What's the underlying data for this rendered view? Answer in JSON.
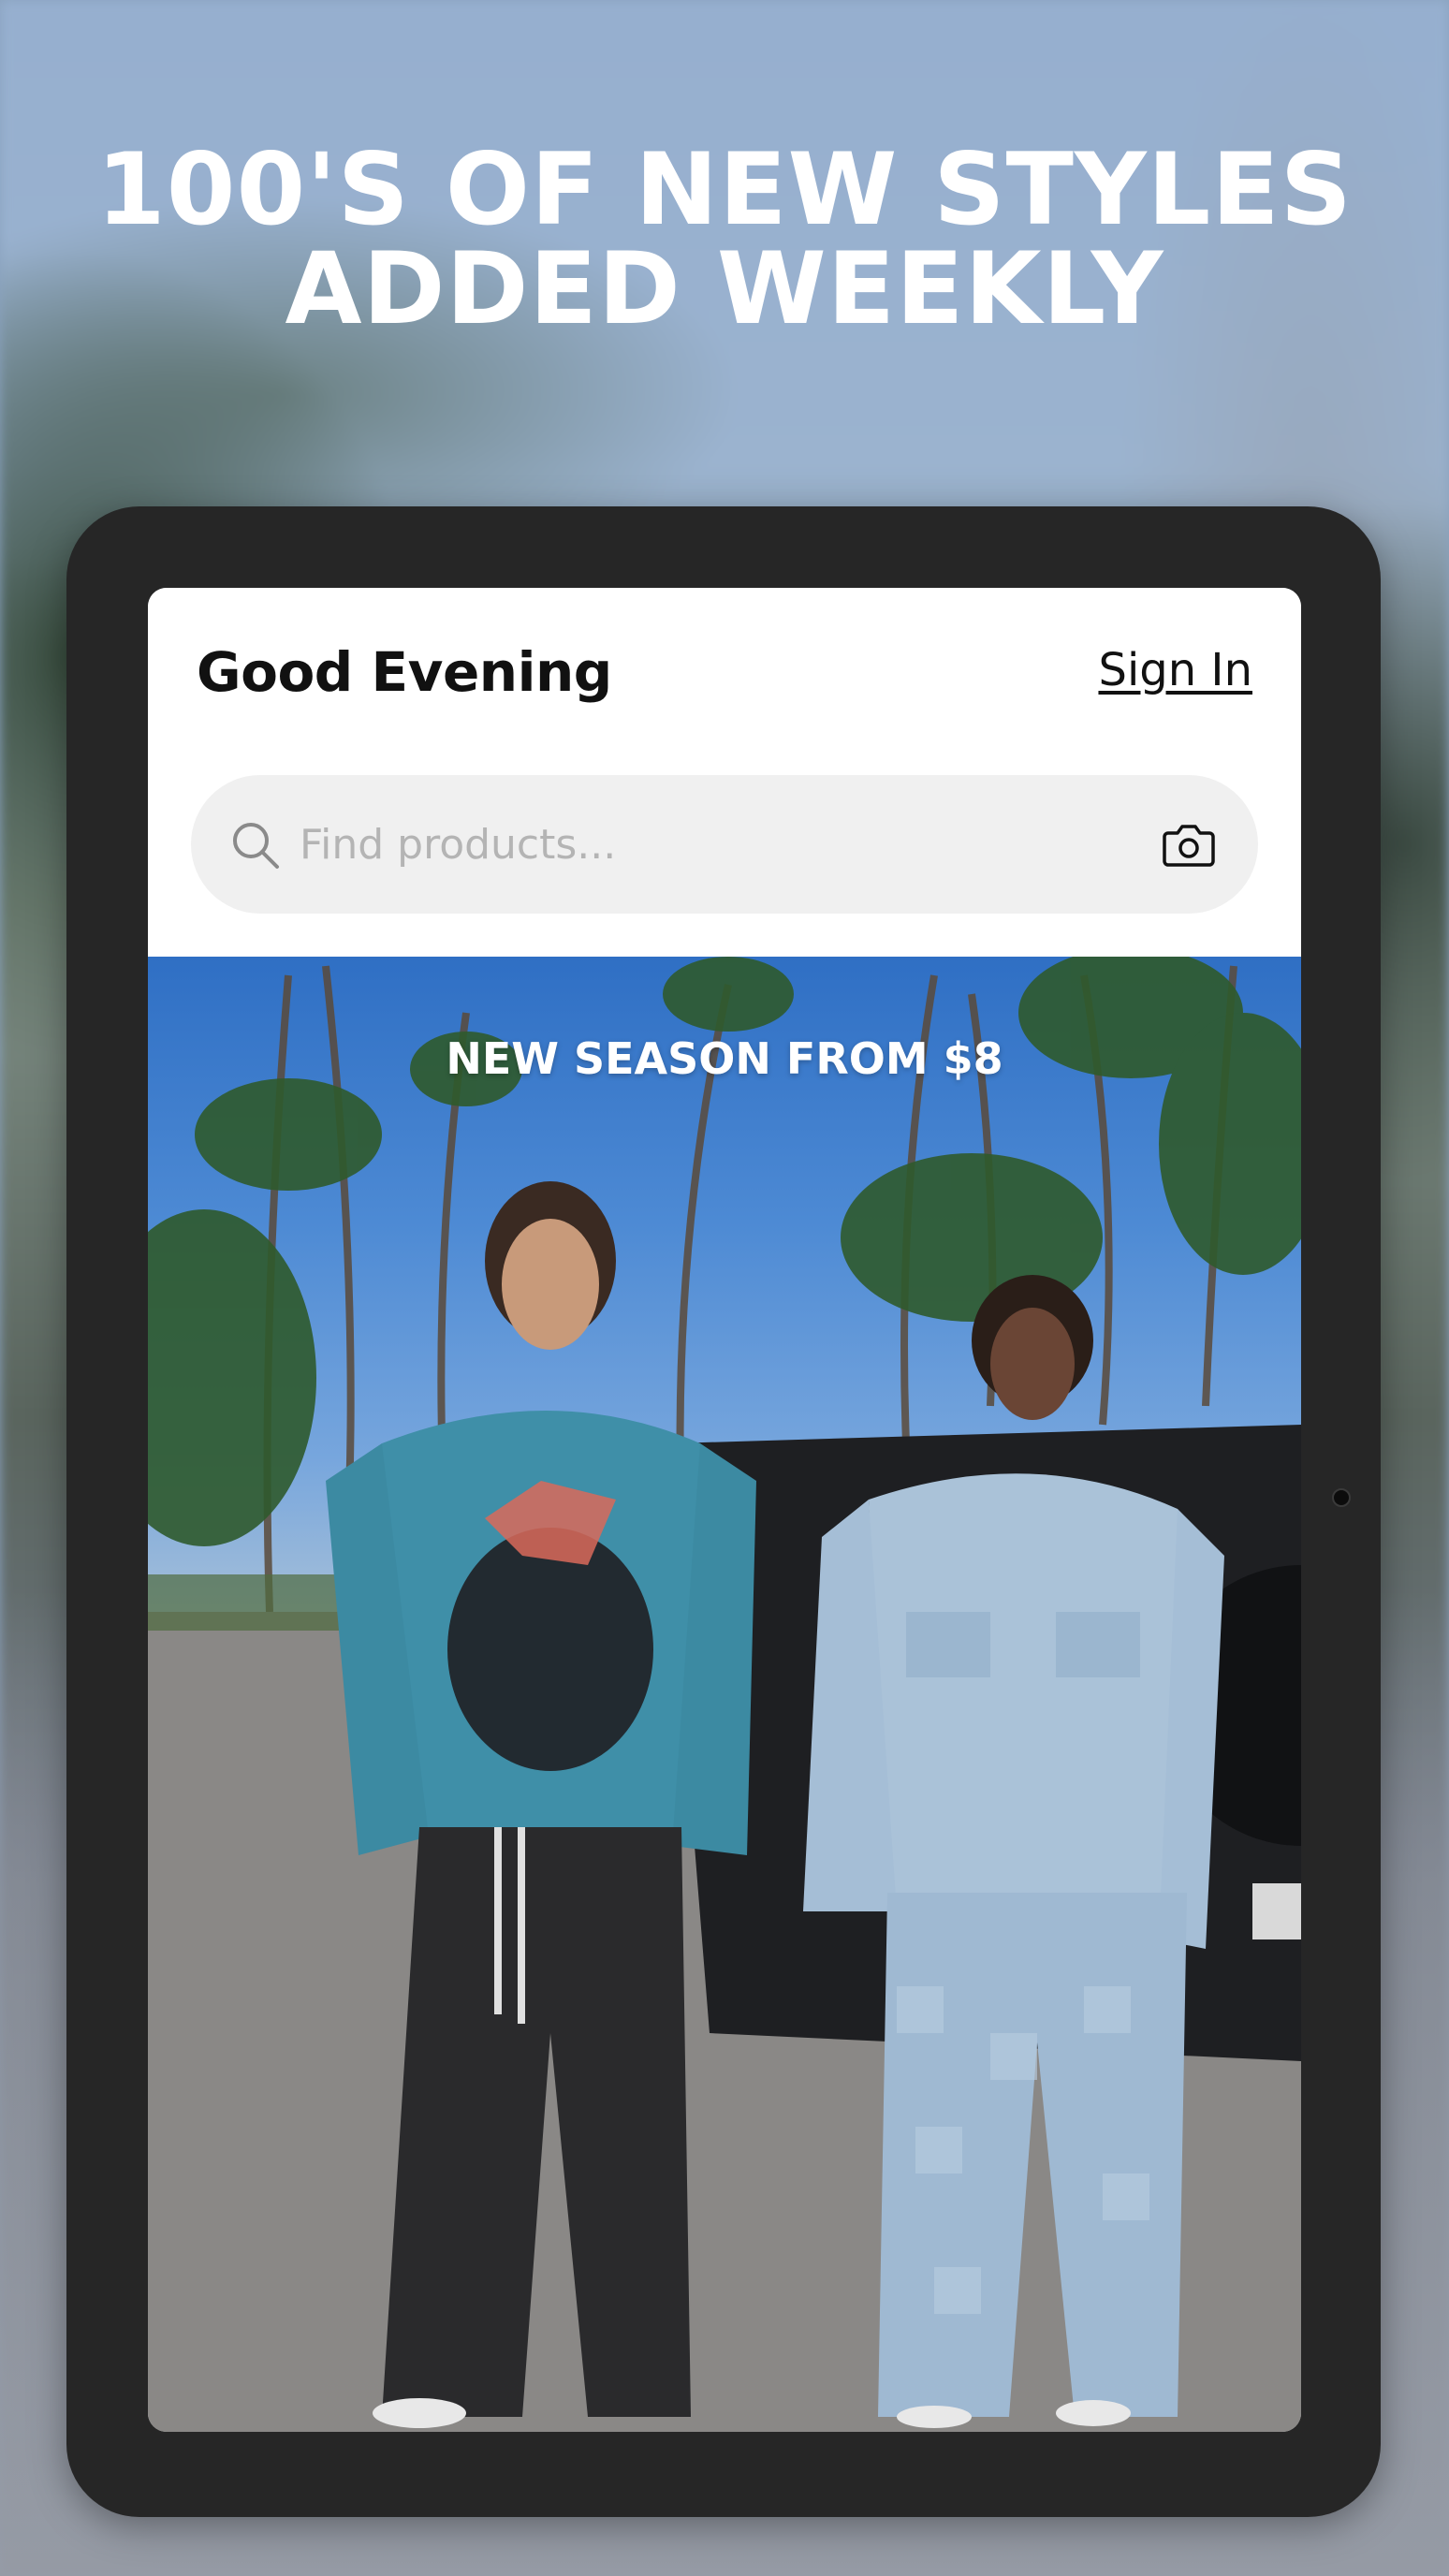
{
  "promo": {
    "headline_line1": "100'S OF NEW STYLES",
    "headline_line2": "ADDED WEEKLY"
  },
  "app": {
    "greeting": "Good Evening",
    "sign_in_label": "Sign In",
    "search": {
      "placeholder": "Find products...",
      "value": ""
    },
    "banner": {
      "title": "NEW SEASON FROM $8"
    }
  },
  "icons": {
    "search": "search-icon",
    "camera": "camera-icon"
  },
  "colors": {
    "device_frame": "#262626",
    "search_bg": "#f0f0f0",
    "text_primary": "#111111",
    "placeholder": "#b4b4b4"
  }
}
